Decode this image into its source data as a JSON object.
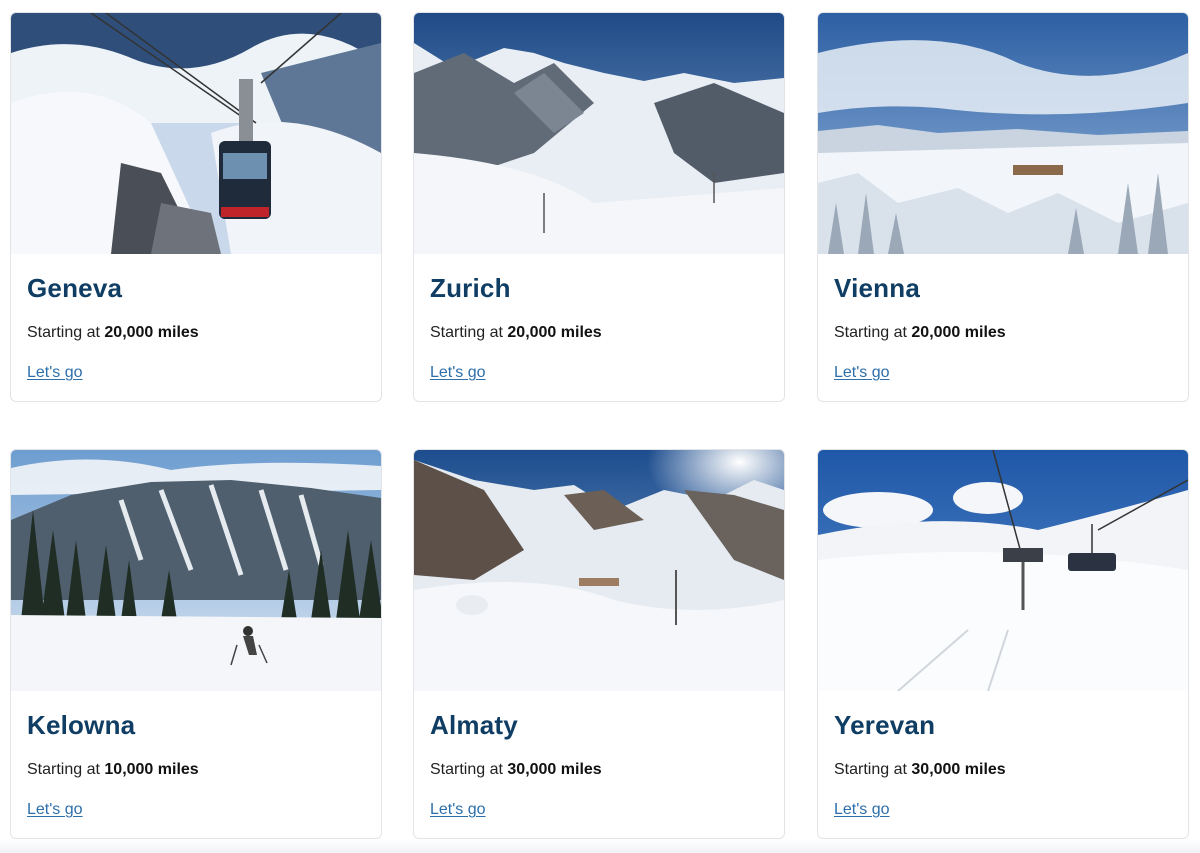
{
  "destinations": [
    {
      "city": "Geneva",
      "price_prefix": "Starting at",
      "price": "20,000 miles",
      "cta": "Let's go",
      "image": "gondola-over-snowy-peaks"
    },
    {
      "city": "Zurich",
      "price_prefix": "Starting at",
      "price": "20,000 miles",
      "cta": "Let's go",
      "image": "alpine-ski-valley"
    },
    {
      "city": "Vienna",
      "price_prefix": "Starting at",
      "price": "20,000 miles",
      "cta": "Let's go",
      "image": "snow-covered-forest-plateau"
    },
    {
      "city": "Kelowna",
      "price_prefix": "Starting at",
      "price": "10,000 miles",
      "cta": "Let's go",
      "image": "skier-on-groomed-slope"
    },
    {
      "city": "Almaty",
      "price_prefix": "Starting at",
      "price": "30,000 miles",
      "cta": "Let's go",
      "image": "mountain-ski-resort-valley"
    },
    {
      "city": "Yerevan",
      "price_prefix": "Starting at",
      "price": "30,000 miles",
      "cta": "Let's go",
      "image": "chairlift-over-snowfield"
    }
  ],
  "colors": {
    "title": "#0f3d63",
    "link": "#2c6fab",
    "border": "#e2e4e8"
  }
}
